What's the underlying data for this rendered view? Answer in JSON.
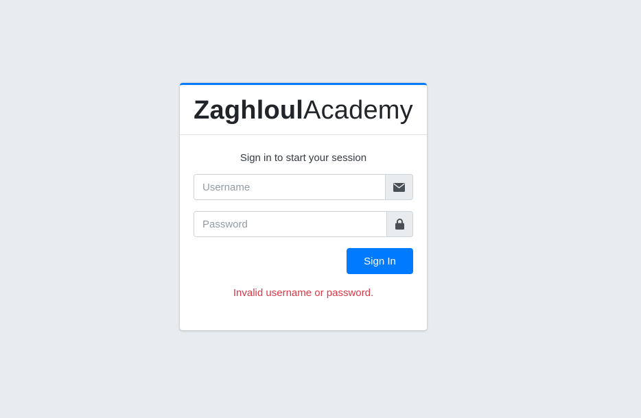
{
  "brand": {
    "bold": "Zaghloul",
    "light": "Academy"
  },
  "login": {
    "message": "Sign in to start your session",
    "username_placeholder": "Username",
    "password_placeholder": "Password",
    "sign_in_label": "Sign In",
    "error_message": "Invalid username or password."
  },
  "icons": {
    "username_icon": "envelope-icon",
    "password_icon": "lock-icon"
  },
  "colors": {
    "accent": "#007bff",
    "error": "#dc3545",
    "background": "#e9ecef"
  }
}
